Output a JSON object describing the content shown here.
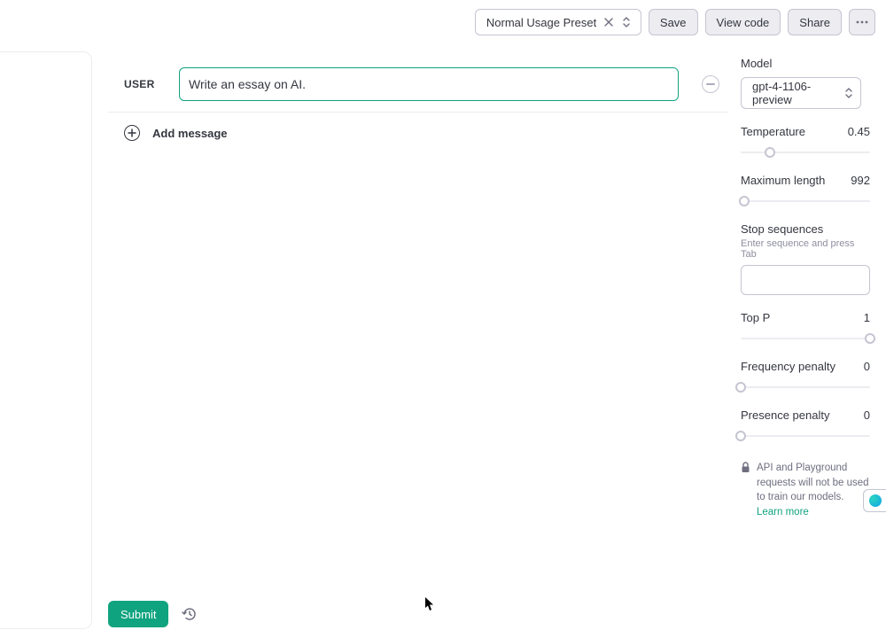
{
  "toolbar": {
    "preset_name": "Normal Usage Preset",
    "save_label": "Save",
    "view_code_label": "View code",
    "share_label": "Share"
  },
  "chat": {
    "role_label": "USER",
    "message_value": "Write an essay on AI.",
    "add_message_label": "Add message"
  },
  "settings": {
    "model_label": "Model",
    "model_value": "gpt-4-1106-preview",
    "temperature_label": "Temperature",
    "temperature_value": "0.45",
    "temperature_pct": 22.5,
    "maxlen_label": "Maximum length",
    "maxlen_value": "992",
    "maxlen_pct": 3,
    "stop_label": "Stop sequences",
    "stop_hint": "Enter sequence and press Tab",
    "topp_label": "Top P",
    "topp_value": "1",
    "topp_pct": 100,
    "freq_label": "Frequency penalty",
    "freq_value": "0",
    "freq_pct": 0,
    "pres_label": "Presence penalty",
    "pres_value": "0",
    "pres_pct": 0
  },
  "notice": {
    "text": "API and Playground requests will not be used to train our models. ",
    "link": "Learn more"
  },
  "footer": {
    "submit_label": "Submit"
  }
}
